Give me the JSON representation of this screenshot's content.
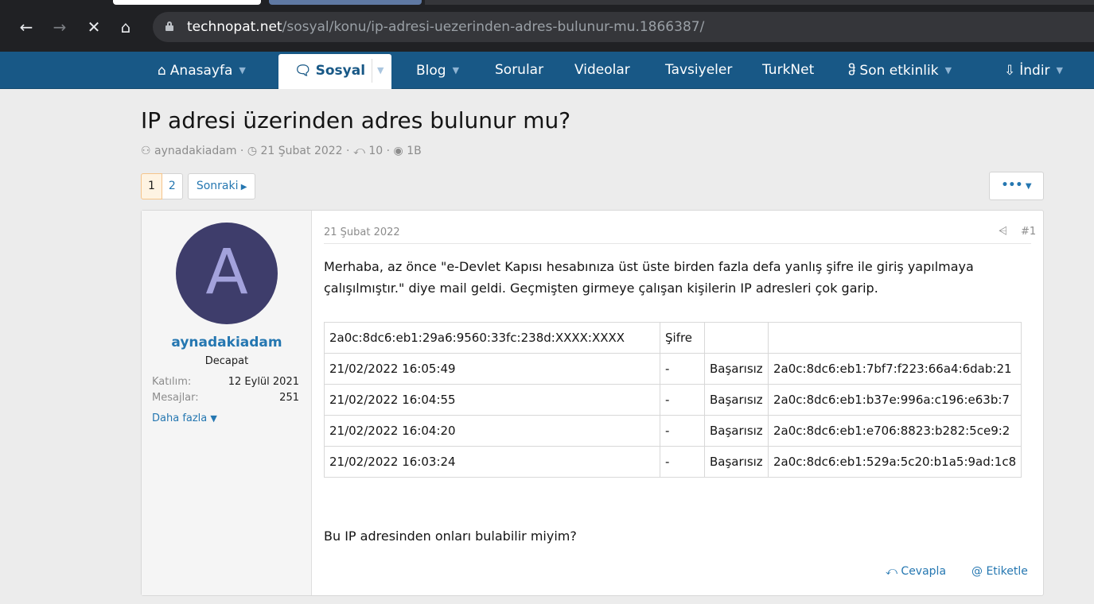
{
  "browser": {
    "url_host": "technopat.net",
    "url_path": "/sosyal/konu/ip-adresi-uezerinden-adres-bulunur-mu.1866387/"
  },
  "nav": {
    "items": [
      {
        "label": "Anasayfa",
        "icon": "home-icon",
        "has_caret": true
      },
      {
        "label": "Sosyal",
        "icon": "chat-icon",
        "has_caret": true,
        "active": true
      },
      {
        "label": "Blog",
        "has_caret": true
      },
      {
        "label": "Sorular"
      },
      {
        "label": "Videolar"
      },
      {
        "label": "Tavsiyeler"
      },
      {
        "label": "TurkNet"
      },
      {
        "label": "Son etkinlik",
        "icon": "bulb-icon",
        "has_caret": true
      },
      {
        "label": "İndir",
        "icon": "download-icon",
        "has_caret": true
      }
    ]
  },
  "thread": {
    "title": "IP adresi üzerinden adres bulunur mu?",
    "author": "aynadakiadam",
    "date": "21 Şubat 2022",
    "replies": "10",
    "views": "1B"
  },
  "pager": {
    "pages": [
      "1",
      "2"
    ],
    "current": "1",
    "next_label": "Sonraki",
    "more_label": "•••"
  },
  "post": {
    "user": {
      "avatar_letter": "A",
      "name": "aynadakiadam",
      "role": "Decapat",
      "joined_label": "Katılım:",
      "joined_value": "12 Eylül 2021",
      "messages_label": "Mesajlar:",
      "messages_value": "251",
      "more_label": "Daha fazla"
    },
    "date": "21 Şubat 2022",
    "number": "#1",
    "text": "Merhaba, az önce \"e-Devlet Kapısı hesabınıza üst üste birden fazla defa yanlış şifre ile giriş yapılmaya çalışılmıştır.\" diye mail geldi. Geçmişten girmeye çalışan kişilerin IP adresleri çok garip.",
    "table": [
      [
        "2a0c:8dc6:eb1:29a6:9560:33fc:238d:XXXX:XXXX",
        "Şifre",
        "",
        ""
      ],
      [
        "21/02/2022 16:05:49",
        "-",
        "Başarısız",
        "2a0c:8dc6:eb1:7bf7:f223:66a4:6dab:21"
      ],
      [
        "21/02/2022 16:04:55",
        "-",
        "Başarısız",
        "2a0c:8dc6:eb1:b37e:996a:c196:e63b:7"
      ],
      [
        "21/02/2022 16:04:20",
        "-",
        "Başarısız",
        "2a0c:8dc6:eb1:e706:8823:b282:5ce9:2"
      ],
      [
        "21/02/2022 16:03:24",
        "-",
        "Başarısız",
        "2a0c:8dc6:eb1:529a:5c20:b1a5:9ad:1c8"
      ]
    ],
    "question": "Bu IP adresinden onları bulabilir miyim?",
    "reply_label": "Cevapla",
    "tag_label": "@ Etiketle"
  },
  "colors": {
    "nav_bg": "#185886",
    "link": "#2577b1",
    "avatar_bg": "#3e3d6b"
  }
}
